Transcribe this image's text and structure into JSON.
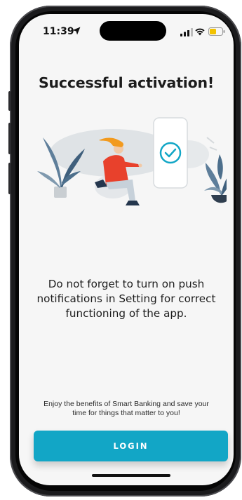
{
  "status_bar": {
    "time": "11:39",
    "location_icon": "location-arrow-icon",
    "signal_icon": "cellular-signal-icon",
    "wifi_icon": "wifi-icon",
    "battery_icon": "battery-low-icon",
    "battery_color": "#f2c200"
  },
  "activation": {
    "title": "Successful activation!",
    "illustration": "person-with-phone-checkmark-illustration",
    "notice": "Do not forget to turn on push notifications in Setting for correct functioning of the app.",
    "benefits": "Enjoy the benefits of Smart Banking and save your time for things that matter to you!",
    "login_label": "LOGIN"
  },
  "colors": {
    "accent": "#12a6c6",
    "background": "#f6f6f6",
    "title_text": "#1c1c1c"
  }
}
